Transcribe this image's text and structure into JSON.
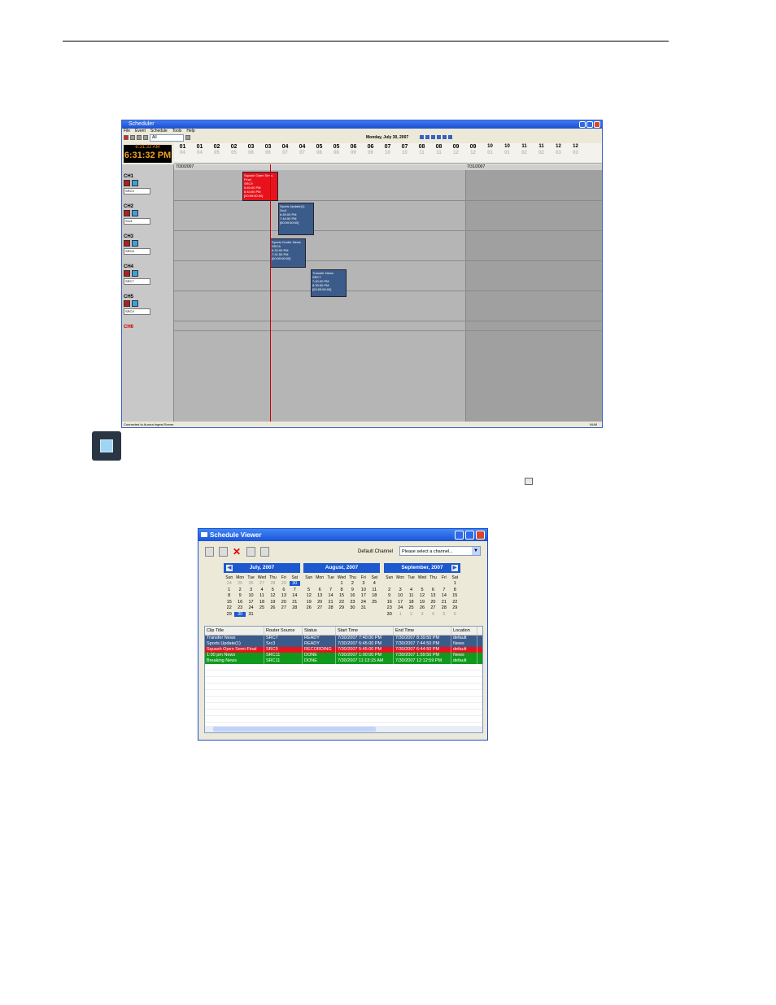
{
  "scheduler": {
    "title": "Scheduler",
    "menu": [
      "File",
      "Event",
      "Schedule",
      "Tools",
      "Help"
    ],
    "toolbar_select": "All",
    "date": "Monday, July 30, 2007",
    "clock_small": "6:31:32 AM",
    "clock_big": "6:31:32 PM",
    "timeline_top": [
      "01",
      "01",
      "02",
      "02",
      "03",
      "03",
      "04",
      "04",
      "05",
      "05",
      "06",
      "06",
      "07",
      "07",
      "08",
      "08",
      "09",
      "09",
      "10",
      "10",
      "11",
      "11",
      "12",
      "12"
    ],
    "timeline_bottom": [
      "04",
      "04",
      "05",
      "05",
      "06",
      "06",
      "07",
      "07",
      "08",
      "08",
      "09",
      "09",
      "10",
      "10",
      "11",
      "11",
      "12",
      "12",
      "01",
      "01",
      "02",
      "02",
      "03",
      "03"
    ],
    "grid_date_left": "7/30/2007",
    "grid_date_right": "7/31/2007",
    "channels": [
      {
        "label": "CH1",
        "source": "SRC9",
        "alt": "43"
      },
      {
        "label": "CH2",
        "source": "Src3",
        "alt": "43"
      },
      {
        "label": "CH3",
        "source": "SRC8",
        "alt": "43"
      },
      {
        "label": "CH4",
        "source": "SRC7",
        "alt": "43"
      },
      {
        "label": "CH5",
        "source": "SRC9",
        "alt": "43"
      },
      {
        "label": "CH6",
        "source": "",
        "alt": ""
      }
    ],
    "events": [
      {
        "title": "Squash Open Semi-Final",
        "src": "SRC9",
        "start": "5:45:00 PM",
        "end": "6:44:50 PM",
        "dur": "[00:59:50:00]"
      },
      {
        "title": "Sports Update(1)",
        "src": "Src3",
        "start": "6:45:00 PM",
        "end": "7:44:50 PM",
        "dur": "[00:59:50:00]"
      },
      {
        "title": "Sports Center News",
        "src": "SRC8",
        "start": "6:32:00 PM",
        "end": "7:31:50 PM",
        "dur": "[00:59:50:00]"
      },
      {
        "title": "Transfer News",
        "src": "SRC7",
        "start": "7:40:00 PM",
        "end": "8:39:50 PM",
        "dur": "[00:59:50:00]"
      }
    ],
    "status_left": "Connected to Aurora Ingest Server",
    "status_right": "NUM",
    "colors": {
      "event_blue": "#3b5b8a",
      "event_red": "#e8121c",
      "now_line": "#cc0000"
    }
  },
  "viewer": {
    "title": "Schedule Viewer",
    "default_channel_label": "Default Channel",
    "channel_placeholder": "Please select a channel...",
    "dow": [
      "Sun",
      "Mon",
      "Tue",
      "Wed",
      "Thu",
      "Fri",
      "Sat"
    ],
    "months": [
      {
        "name": "July, 2007",
        "days": [
          "24",
          "25",
          "26",
          "27",
          "28",
          "29",
          "30",
          "1",
          "2",
          "3",
          "4",
          "5",
          "6",
          "7",
          "8",
          "9",
          "10",
          "11",
          "12",
          "13",
          "14",
          "15",
          "16",
          "17",
          "18",
          "19",
          "20",
          "21",
          "22",
          "23",
          "24",
          "25",
          "26",
          "27",
          "28",
          "29",
          "30",
          "31"
        ]
      },
      {
        "name": "August, 2007",
        "days": [
          "1",
          "2",
          "3",
          "4",
          "5",
          "6",
          "7",
          "8",
          "9",
          "10",
          "11",
          "12",
          "13",
          "14",
          "15",
          "16",
          "17",
          "18",
          "19",
          "20",
          "21",
          "22",
          "23",
          "24",
          "25",
          "26",
          "27",
          "28",
          "29",
          "30",
          "31"
        ]
      },
      {
        "name": "September, 2007",
        "days": [
          "1",
          "2",
          "3",
          "4",
          "5",
          "6",
          "7",
          "8",
          "9",
          "10",
          "11",
          "12",
          "13",
          "14",
          "15",
          "16",
          "17",
          "18",
          "19",
          "20",
          "21",
          "22",
          "23",
          "24",
          "25",
          "26",
          "27",
          "28",
          "29",
          "30",
          "1",
          "2",
          "3",
          "4",
          "5",
          "6"
        ]
      }
    ],
    "columns": [
      "Clip Title",
      "Router Source",
      "Status",
      "Start Time",
      "End Time",
      "Location"
    ],
    "rows": [
      {
        "cells": [
          "Transfer News",
          "SRC7",
          "READY",
          "7/30/2007 7:40:00 PM",
          "7/30/2007 8:39:50 PM",
          "default"
        ],
        "color": "blue"
      },
      {
        "cells": [
          "Sports Update(1)",
          "Src3",
          "READY",
          "7/30/2007 6:45:00 PM",
          "7/30/2007 7:44:50 PM",
          "News"
        ],
        "color": "blue"
      },
      {
        "cells": [
          "Squash Open Semi-Final",
          "SRC9",
          "RECORDING",
          "7/30/2007 5:45:00 PM",
          "7/30/2007 6:44:50 PM",
          "default"
        ],
        "color": "red"
      },
      {
        "cells": [
          "1:00 pm News",
          "SRC11",
          "DONE",
          "7/30/2007 1:00:00 PM",
          "7/30/2007 1:59:50 PM",
          "News"
        ],
        "color": "green"
      },
      {
        "cells": [
          "Breaking News",
          "SRC11",
          "DONE",
          "7/30/2007 11:13:15 AM",
          "7/30/2007 12:12:59 PM",
          "default"
        ],
        "color": "green"
      }
    ]
  }
}
